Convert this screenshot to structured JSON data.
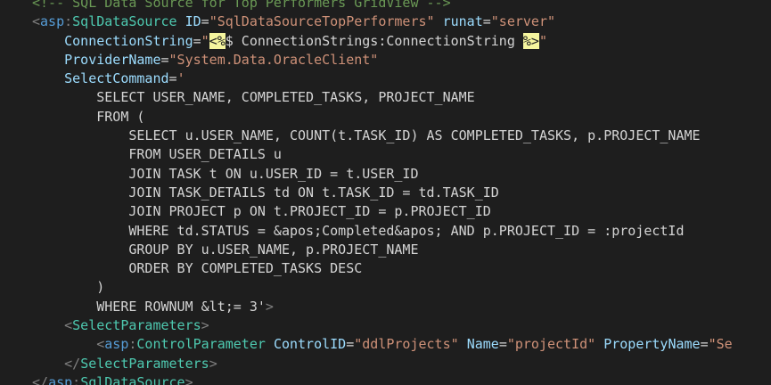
{
  "lines": [
    {
      "indent": "",
      "segments": [
        {
          "t": "<!-- SQL Data Source for Top Performers GridView -->",
          "c": "comment"
        }
      ]
    },
    {
      "indent": "",
      "segments": [
        {
          "t": "<",
          "c": "punct"
        },
        {
          "t": "asp",
          "c": "tag"
        },
        {
          "t": ":",
          "c": "punct"
        },
        {
          "t": "SqlDataSource",
          "c": "tagx"
        },
        {
          "t": " ",
          "c": "txt"
        },
        {
          "t": "ID",
          "c": "attr"
        },
        {
          "t": "=",
          "c": "txt"
        },
        {
          "t": "\"SqlDataSourceTopPerformers\"",
          "c": "str"
        },
        {
          "t": " ",
          "c": "txt"
        },
        {
          "t": "runat",
          "c": "attr"
        },
        {
          "t": "=",
          "c": "txt"
        },
        {
          "t": "\"server\"",
          "c": "str"
        }
      ]
    },
    {
      "indent": "    ",
      "segments": [
        {
          "t": "ConnectionString",
          "c": "attr"
        },
        {
          "t": "=",
          "c": "txt"
        },
        {
          "t": "\"",
          "c": "str"
        },
        {
          "t": "<%",
          "c": "delim"
        },
        {
          "t": "$ ConnectionStrings:ConnectionString ",
          "c": "txt"
        },
        {
          "t": "%>",
          "c": "delim"
        },
        {
          "t": "\"",
          "c": "str"
        }
      ]
    },
    {
      "indent": "    ",
      "segments": [
        {
          "t": "ProviderName",
          "c": "attr"
        },
        {
          "t": "=",
          "c": "txt"
        },
        {
          "t": "\"System.Data.OracleClient\"",
          "c": "str"
        }
      ]
    },
    {
      "indent": "    ",
      "segments": [
        {
          "t": "SelectCommand",
          "c": "attr"
        },
        {
          "t": "=",
          "c": "txt"
        },
        {
          "t": "'",
          "c": "str"
        }
      ]
    },
    {
      "indent": "        ",
      "segments": [
        {
          "t": "SELECT USER_NAME, COMPLETED_TASKS, PROJECT_NAME",
          "c": "txt"
        }
      ]
    },
    {
      "indent": "        ",
      "segments": [
        {
          "t": "FROM (",
          "c": "txt"
        }
      ]
    },
    {
      "indent": "            ",
      "segments": [
        {
          "t": "SELECT u.USER_NAME, COUNT(t.TASK_ID) AS COMPLETED_TASKS, p.PROJECT_NAME",
          "c": "txt"
        }
      ]
    },
    {
      "indent": "            ",
      "segments": [
        {
          "t": "FROM USER_DETAILS u",
          "c": "txt"
        }
      ]
    },
    {
      "indent": "            ",
      "segments": [
        {
          "t": "JOIN TASK t ON u.USER_ID = t.USER_ID",
          "c": "txt"
        }
      ]
    },
    {
      "indent": "            ",
      "segments": [
        {
          "t": "JOIN TASK_DETAILS td ON t.TASK_ID = td.TASK_ID",
          "c": "txt"
        }
      ]
    },
    {
      "indent": "            ",
      "segments": [
        {
          "t": "JOIN PROJECT p ON t.PROJECT_ID = p.PROJECT_ID",
          "c": "txt"
        }
      ]
    },
    {
      "indent": "            ",
      "segments": [
        {
          "t": "WHERE td.STATUS = &apos;Completed&apos; AND p.PROJECT_ID = :projectId",
          "c": "txt"
        }
      ]
    },
    {
      "indent": "            ",
      "segments": [
        {
          "t": "GROUP BY u.USER_NAME, p.PROJECT_NAME",
          "c": "txt"
        }
      ]
    },
    {
      "indent": "            ",
      "segments": [
        {
          "t": "ORDER BY COMPLETED_TASKS DESC",
          "c": "txt"
        }
      ]
    },
    {
      "indent": "        ",
      "segments": [
        {
          "t": ")",
          "c": "txt"
        }
      ]
    },
    {
      "indent": "        ",
      "segments": [
        {
          "t": "WHERE ROWNUM &lt;= 3'",
          "c": "txt"
        },
        {
          "t": ">",
          "c": "punct"
        }
      ]
    },
    {
      "indent": "    ",
      "segments": [
        {
          "t": "<",
          "c": "punct"
        },
        {
          "t": "SelectParameters",
          "c": "tagx"
        },
        {
          "t": ">",
          "c": "punct"
        }
      ]
    },
    {
      "indent": "        ",
      "segments": [
        {
          "t": "<",
          "c": "punct"
        },
        {
          "t": "asp",
          "c": "tag"
        },
        {
          "t": ":",
          "c": "punct"
        },
        {
          "t": "ControlParameter",
          "c": "tagx"
        },
        {
          "t": " ",
          "c": "txt"
        },
        {
          "t": "ControlID",
          "c": "attr"
        },
        {
          "t": "=",
          "c": "txt"
        },
        {
          "t": "\"ddlProjects\"",
          "c": "str"
        },
        {
          "t": " ",
          "c": "txt"
        },
        {
          "t": "Name",
          "c": "attr"
        },
        {
          "t": "=",
          "c": "txt"
        },
        {
          "t": "\"projectId\"",
          "c": "str"
        },
        {
          "t": " ",
          "c": "txt"
        },
        {
          "t": "PropertyName",
          "c": "attr"
        },
        {
          "t": "=",
          "c": "txt"
        },
        {
          "t": "\"Se",
          "c": "str"
        }
      ]
    },
    {
      "indent": "    ",
      "segments": [
        {
          "t": "</",
          "c": "punct"
        },
        {
          "t": "SelectParameters",
          "c": "tagx"
        },
        {
          "t": ">",
          "c": "punct"
        }
      ]
    },
    {
      "indent": "",
      "segments": [
        {
          "t": "</",
          "c": "punct"
        },
        {
          "t": "asp",
          "c": "tag"
        },
        {
          "t": ":",
          "c": "punct"
        },
        {
          "t": "SqlDataSource",
          "c": "tagx"
        },
        {
          "t": ">",
          "c": "punct"
        }
      ]
    }
  ]
}
